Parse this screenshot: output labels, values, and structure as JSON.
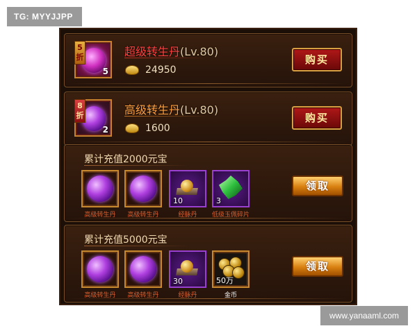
{
  "watermarks": {
    "top_left": "TG: MYYJJPP",
    "bottom_right": "www.yanaaml.com"
  },
  "offers": [
    {
      "discount": "5折",
      "item_count": "5",
      "name": "超级转生丹",
      "level": "(Lv.80)",
      "price": "24950",
      "button": "购买",
      "frame": "red"
    },
    {
      "discount": "8折",
      "item_count": "2",
      "name": "高级转生丹",
      "level": "(Lv.80)",
      "price": "1600",
      "button": "购买",
      "frame": "dark"
    }
  ],
  "rewards": [
    {
      "title": "累计充值2000元宝",
      "button": "领取",
      "items": [
        {
          "icon": "purple-orb-icon",
          "count": "",
          "label": "高级转生丹"
        },
        {
          "icon": "purple-orb-icon",
          "count": "",
          "label": "高级转生丹"
        },
        {
          "icon": "gold-pellet-icon",
          "count": "10",
          "label": "经脉丹"
        },
        {
          "icon": "jade-shard-icon",
          "count": "3",
          "label": "低级玉佩碎片"
        }
      ]
    },
    {
      "title": "累计充值5000元宝",
      "button": "领取",
      "items": [
        {
          "icon": "purple-orb-icon",
          "count": "",
          "label": "高级转生丹"
        },
        {
          "icon": "purple-orb-icon",
          "count": "",
          "label": "高级转生丹"
        },
        {
          "icon": "gold-pellet-icon",
          "count": "30",
          "label": "经脉丹"
        },
        {
          "icon": "gold-coins-icon",
          "count": "50万",
          "label": "金币"
        }
      ]
    }
  ],
  "colors": {
    "panel": "#1c0f07",
    "border": "#7a5128",
    "name_red": "#ff4040",
    "name_orange": "#ffa040",
    "buy_button": "#8a1010",
    "claim_button": "#d88010"
  }
}
